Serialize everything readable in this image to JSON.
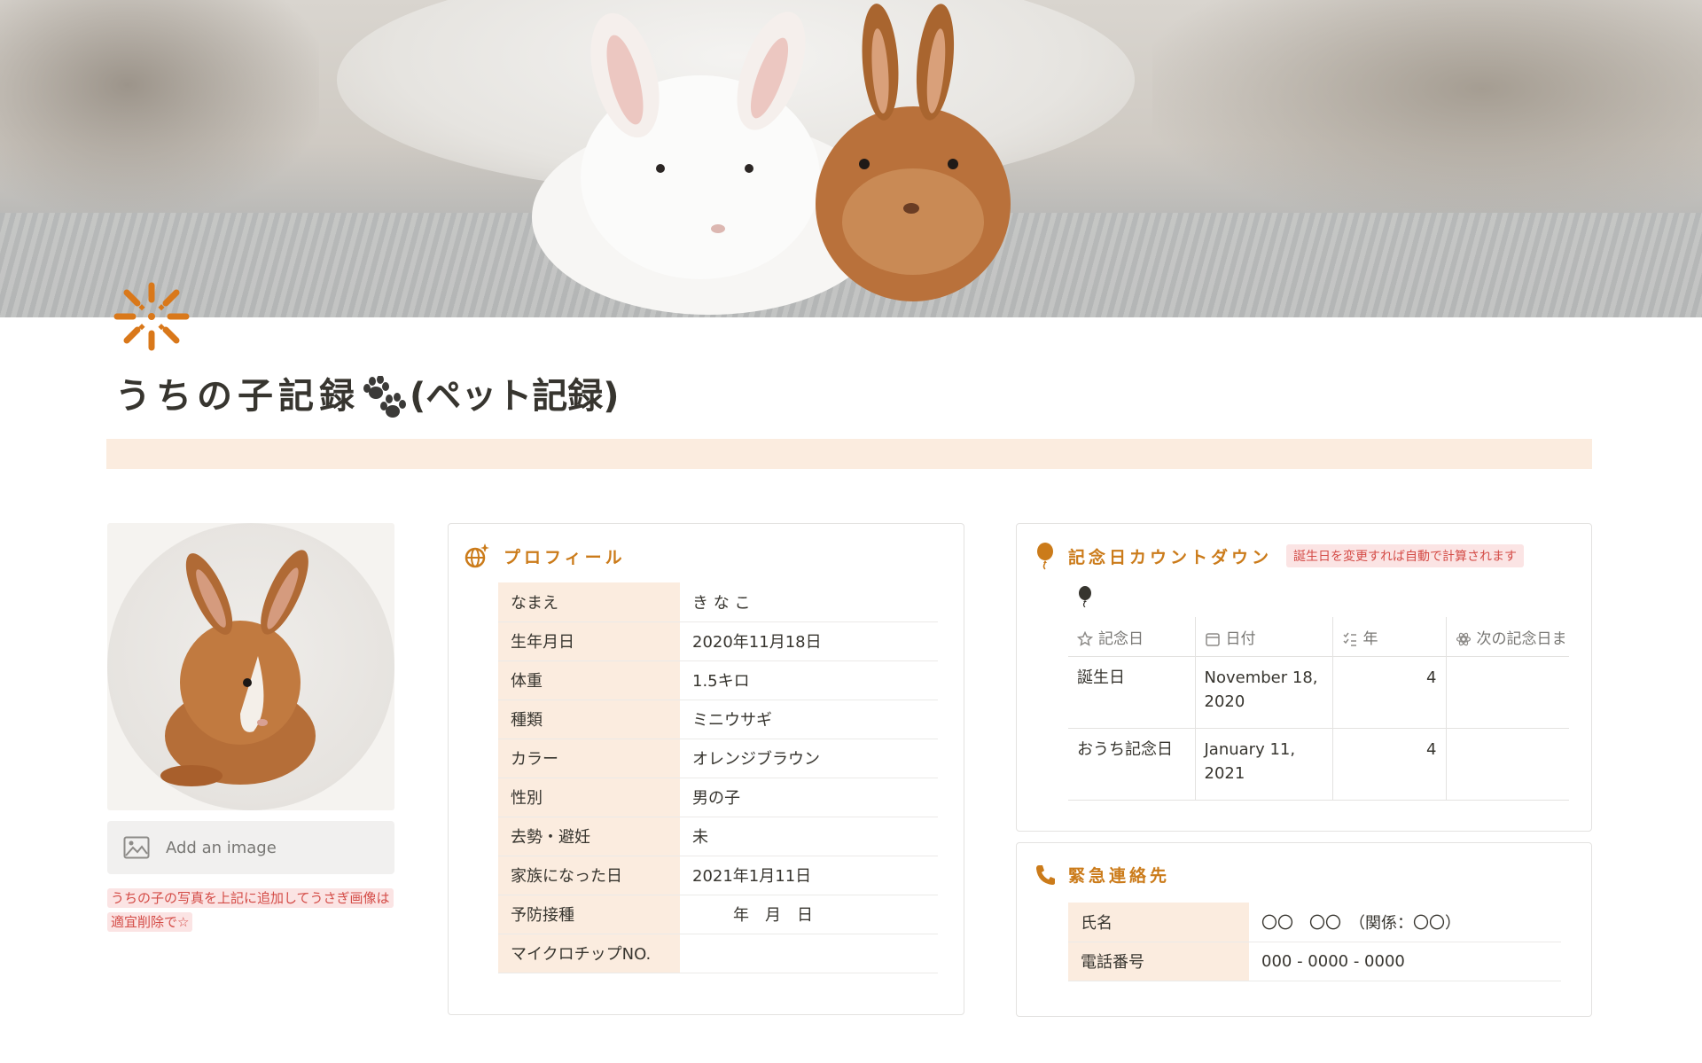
{
  "page": {
    "title": "うちの子記録",
    "title_suffix": "(ペット記録)",
    "accent_color": "#cb7b1a",
    "banner_color": "#fbecdf"
  },
  "left": {
    "add_image_label": "Add an image",
    "note": "うちの子の写真を上記に追加してうさぎ画像は適宜削除で☆"
  },
  "profile": {
    "title": "プロフィール",
    "rows": [
      {
        "key": "なまえ",
        "value": "き な こ"
      },
      {
        "key": "生年月日",
        "value": "2020年11月18日"
      },
      {
        "key": "体重",
        "value": "1.5キロ"
      },
      {
        "key": "種類",
        "value": "ミニウサギ"
      },
      {
        "key": "カラー",
        "value": "オレンジブラウン"
      },
      {
        "key": "性別",
        "value": "男の子"
      },
      {
        "key": "去勢・避妊",
        "value": "未"
      },
      {
        "key": "家族になった日",
        "value": "2021年1月11日"
      },
      {
        "key": "予防接種",
        "value": "年　月　日"
      },
      {
        "key": "マイクロチップNO.",
        "value": ""
      }
    ]
  },
  "countdown": {
    "title": "記念日カウントダウン",
    "tag": "誕生日を変更すれば自動で計算されます",
    "columns": [
      "記念日",
      "日付",
      "年",
      "次の記念日ま"
    ],
    "column_icons": [
      "star-icon",
      "calendar-icon",
      "checklist-icon",
      "formula-icon"
    ],
    "rows": [
      {
        "name": "誕生日",
        "date": "November 18, 2020",
        "years": "4",
        "next": ""
      },
      {
        "name": "おうち記念日",
        "date": "January 11, 2021",
        "years": "4",
        "next": ""
      }
    ]
  },
  "emergency": {
    "title": "緊急連絡先",
    "rows": [
      {
        "key": "氏名",
        "value": "〇〇　〇〇　（関係：〇〇）"
      },
      {
        "key": "電話番号",
        "value": "000 - 0000 - 0000"
      }
    ]
  }
}
